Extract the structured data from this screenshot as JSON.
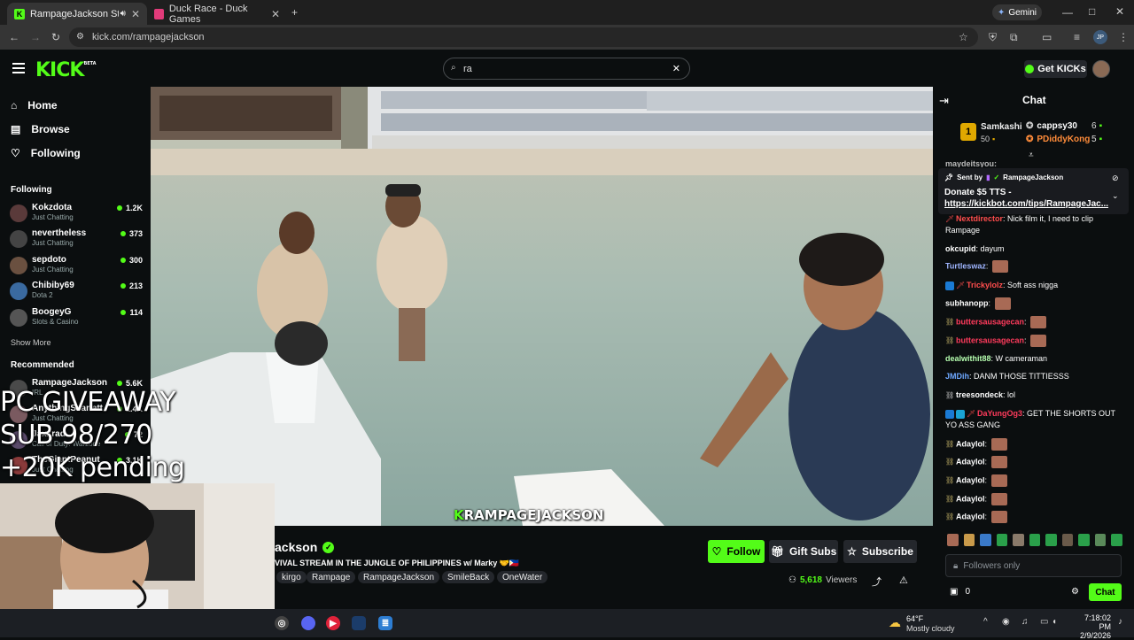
{
  "browser": {
    "tabs": [
      {
        "title": "RampageJackson Stream - "
      },
      {
        "title": "Duck Race - Duck Games"
      }
    ],
    "url": "kick.com/rampagejackson",
    "gemini": "Gemini",
    "profile": "JP"
  },
  "header": {
    "logo": "KICK",
    "logo_badge": "BETA",
    "search_value": "ra",
    "get_kicks": "Get KICKs"
  },
  "sidebar": {
    "nav": [
      {
        "label": "Home",
        "icon": "home-icon"
      },
      {
        "label": "Browse",
        "icon": "browse-icon"
      },
      {
        "label": "Following",
        "icon": "heart-icon"
      }
    ],
    "following_title": "Following",
    "following": [
      {
        "name": "Kokzdota",
        "category": "Just Chatting",
        "viewers": "1.2K"
      },
      {
        "name": "nevertheless",
        "category": "Just Chatting",
        "viewers": "373"
      },
      {
        "name": "sepdoto",
        "category": "Just Chatting",
        "viewers": "300"
      },
      {
        "name": "Chibiby69",
        "category": "Dota 2",
        "viewers": "213"
      },
      {
        "name": "BoogeyG",
        "category": "Slots & Casino",
        "viewers": "114"
      }
    ],
    "show_more": "Show More",
    "recommended_title": "Recommended",
    "recommended": [
      {
        "name": "RampageJackson",
        "category": "IRL",
        "viewers": "5.6K"
      },
      {
        "name": "AnythingScarlett",
        "category": "Just Chatting",
        "viewers": "1.4K"
      },
      {
        "name": "Jaxxrad",
        "category": "Call of Duty: Warzone",
        "viewers": "72"
      },
      {
        "name": "TheGiantPeanut",
        "category": "Just Chatting",
        "viewers": "3.1K"
      }
    ]
  },
  "overlay": {
    "line1": "PC GIVEAWAY",
    "line2": "SUB 98/270",
    "line3": "+20K pending"
  },
  "video": {
    "watermark": "RAMPAGEJACKSON"
  },
  "stream": {
    "channel": "RampageJackson",
    "channel_visible": "ackson",
    "title": "SURVIVAL STREAM IN THE JUNGLE OF PHILIPPINES w/ Marky 🤝🇵🇭",
    "title_visible": "VIVAL STREAM IN THE JUNGLE OF PHILIPPINES w/ Marky 🤝🇵🇭",
    "tags": [
      "kirgo",
      "Rampage",
      "RampageJackson",
      "SmileBack",
      "OneWater"
    ],
    "follow": "Follow",
    "gift_subs": "Gift Subs",
    "subscribe": "Subscribe",
    "viewers": "5,618",
    "viewers_label": "Viewers",
    "accent": "#53fc18"
  },
  "chat": {
    "title": "Chat",
    "leaderboard": [
      {
        "rank": "1",
        "name": "Samkashi",
        "amount": "50"
      },
      {
        "name": "cappsy30",
        "amount": "6"
      },
      {
        "name": "PDiddyKong",
        "amount": "5"
      }
    ],
    "partial_top": "maydeitsyou:",
    "pinned": {
      "sent_by": "Sent by",
      "author": "RampageJackson",
      "line1": "Donate $5 TTS -",
      "line2": "https://kickbot.com/tips/RampageJac..."
    },
    "messages": [
      {
        "user": "Nextdirector",
        "color": "#ff4d4d",
        "text": "Nick film it, I need to clip Rampage"
      },
      {
        "user": "okcupid",
        "color": "#ffffff",
        "text": "dayum"
      },
      {
        "user": "Turtleswaz",
        "color": "#9fb5ff",
        "text": ""
      },
      {
        "user": "Trickylolz",
        "color": "#ff4d4d",
        "text": "Soft ass nigga"
      },
      {
        "user": "subhanopp",
        "color": "#ffffff",
        "text": ""
      },
      {
        "user": "buttersausagecan",
        "color": "#ff3b5c",
        "text": ""
      },
      {
        "user": "buttersausagecan",
        "color": "#ff3b5c",
        "text": ""
      },
      {
        "user": "dealwithit88",
        "color": "#ffffff",
        "text": "W cameraman"
      },
      {
        "user": "JMDih",
        "color": "#6ea8ff",
        "text": "DANM THOSE TITTIESSS"
      },
      {
        "user": "treesondeck",
        "color": "#ffffff",
        "text": "lol"
      },
      {
        "user": "DaYungOg3",
        "color": "#ff3b5c",
        "text": "GET THE SHORTS OUT YO ASS GANG"
      },
      {
        "user": "Adaylol",
        "color": "#ffffff",
        "text": ""
      },
      {
        "user": "Adaylol",
        "color": "#ffffff",
        "text": ""
      },
      {
        "user": "Adaylol",
        "color": "#ffffff",
        "text": ""
      },
      {
        "user": "Adaylol",
        "color": "#ffffff",
        "text": ""
      },
      {
        "user": "Adaylol",
        "color": "#ffffff",
        "text": ""
      }
    ],
    "input_placeholder": "Followers only",
    "kicks_count": "0",
    "send": "Chat"
  },
  "taskbar": {
    "weather_temp": "64°F",
    "weather_desc": "Mostly cloudy",
    "time": "7:18:02 PM",
    "date": "2/9/2026"
  }
}
